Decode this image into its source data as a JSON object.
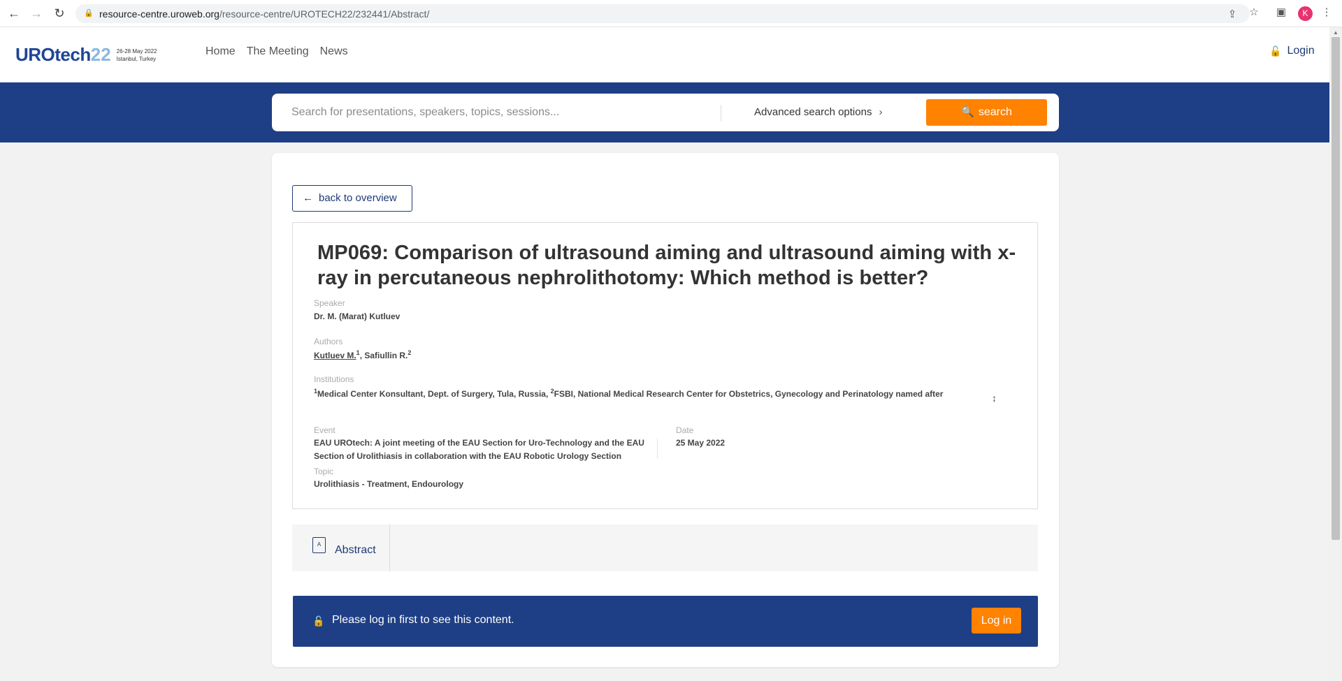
{
  "browser": {
    "url_host": "resource-centre.uroweb.org",
    "url_path": "/resource-centre/UROTECH22/232441/Abstract/",
    "avatar_letter": "K"
  },
  "header": {
    "logo_main": "UROtech",
    "logo_num": "22",
    "logo_date": "26-28 May 2022",
    "logo_place": "Istanbul, Turkey",
    "nav": [
      "Home",
      "The Meeting",
      "News"
    ],
    "login_label": "Login"
  },
  "search": {
    "placeholder": "Search for presentations, speakers, topics, sessions...",
    "advanced_label": "Advanced search options",
    "button_label": "search"
  },
  "detail": {
    "back_label": "back to overview",
    "title": "MP069: Comparison of ultrasound aiming and ultrasound aiming with x-ray in percutaneous nephrolithotomy: Which method is better?",
    "speaker_label": "Speaker",
    "speaker": "Dr. M. (Marat) Kutluev",
    "authors_label": "Authors",
    "author1": "Kutluev M.",
    "author1_sup": "1",
    "author_sep": ", Safiullin R.",
    "author2_sup": "2",
    "institutions_label": "Institutions",
    "inst1_sup": "1",
    "inst1": "Medical Center Konsultant, Dept. of Surgery, Tula, Russia, ",
    "inst2_sup": "2",
    "inst2": "FSBI, National Medical Research Center for Obstetrics, Gynecology and Perinatology named after",
    "event_label": "Event",
    "event_line1": "EAU UROtech: A joint meeting of the EAU Section for Uro-Technology and the EAU",
    "event_line2": "Section of Urolithiasis in collaboration with the EAU Robotic Urology Section",
    "date_label": "Date",
    "date": "25 May 2022",
    "topic_label": "Topic",
    "topic": "Urolithiasis - Treatment, Endourology"
  },
  "tabs": {
    "abstract_label": "Abstract"
  },
  "login_prompt": {
    "message": "Please log in first to see this content.",
    "button_label": "Log in"
  },
  "colors": {
    "brand_blue": "#1e3f85",
    "accent_orange": "#ff8200"
  }
}
